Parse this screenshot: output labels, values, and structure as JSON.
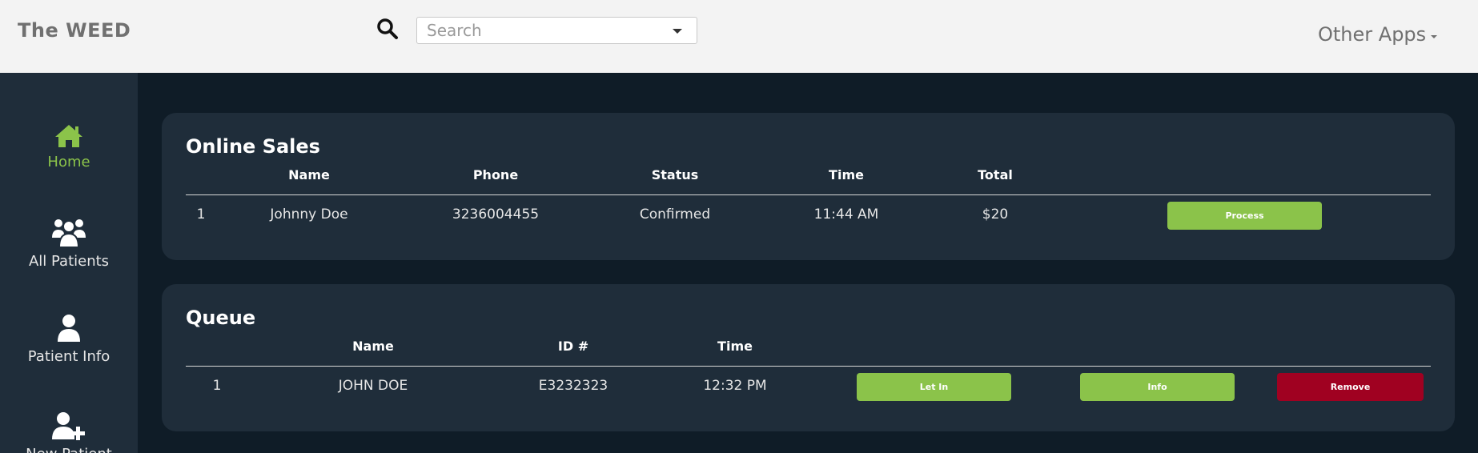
{
  "header": {
    "brand": "The WEED",
    "search_placeholder": "Search",
    "other_apps_label": "Other Apps"
  },
  "sidebar": {
    "items": [
      {
        "label": "Home",
        "icon": "home-icon",
        "active": true
      },
      {
        "label": "All Patients",
        "icon": "users-icon",
        "active": false
      },
      {
        "label": "Patient Info",
        "icon": "user-icon",
        "active": false
      },
      {
        "label": "New Patient",
        "icon": "user-plus-icon",
        "active": false
      }
    ]
  },
  "online_sales": {
    "title": "Online Sales",
    "columns": [
      "Name",
      "Phone",
      "Status",
      "Time",
      "Total"
    ],
    "rows": [
      {
        "index": "1",
        "name": "Johnny Doe",
        "phone": "3236004455",
        "status": "Confirmed",
        "time": "11:44 AM",
        "total": "$20",
        "action": "Process"
      }
    ]
  },
  "queue": {
    "title": "Queue",
    "columns": [
      "Name",
      "ID #",
      "Time"
    ],
    "rows": [
      {
        "index": "1",
        "name": "JOHN DOE",
        "id": "E3232323",
        "time": "12:32 PM",
        "let_in": "Let In",
        "info": "Info",
        "remove": "Remove"
      }
    ]
  },
  "colors": {
    "accent": "#8bc34a",
    "danger": "#a00121",
    "page_bg": "#0f1c27",
    "panel_bg": "#1f2d3a",
    "topbar_bg": "#f3f3f3"
  }
}
